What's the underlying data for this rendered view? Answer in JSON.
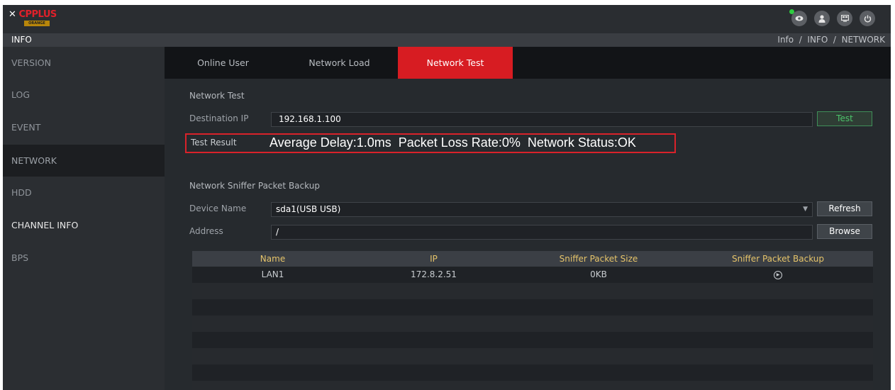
{
  "brand": {
    "logo_text_1": "CP",
    "logo_text_2": "PLUS",
    "logo_sub": "ORANGE"
  },
  "top_icons": [
    "eye-icon",
    "user-icon",
    "display-icon",
    "power-icon"
  ],
  "infobar": {
    "title": "INFO",
    "breadcrumb": "Info  /  INFO  /  NETWORK"
  },
  "sidebar": {
    "items": [
      {
        "label": "VERSION"
      },
      {
        "label": "LOG"
      },
      {
        "label": "EVENT"
      },
      {
        "label": "NETWORK"
      },
      {
        "label": "HDD"
      },
      {
        "label": "CHANNEL INFO"
      },
      {
        "label": "BPS"
      }
    ],
    "active": "NETWORK"
  },
  "tabs": [
    {
      "label": "Online User"
    },
    {
      "label": "Network Load"
    },
    {
      "label": "Network Test"
    }
  ],
  "network_test": {
    "section_title": "Network Test",
    "dest_ip_label": "Destination IP",
    "dest_ip_value": "192.168.1.100",
    "test_button": "Test",
    "result_label": "Test Result",
    "result_value": "Average Delay:1.0ms  Packet Loss Rate:0%  Network Status:OK"
  },
  "sniffer": {
    "section_title": "Network Sniffer Packet Backup",
    "device_label": "Device Name",
    "device_value": "sda1(USB USB)",
    "refresh_button": "Refresh",
    "address_label": "Address",
    "address_value": "/",
    "browse_button": "Browse"
  },
  "table": {
    "headers": [
      "Name",
      "IP",
      "Sniffer Packet Size",
      "Sniffer Packet Backup"
    ],
    "rows": [
      {
        "name": "LAN1",
        "ip": "172.8.2.51",
        "size": "0KB"
      }
    ]
  },
  "colors": {
    "accent": "#d71c22",
    "header_text": "#e6c46a",
    "test_button": "#4cc46b"
  }
}
